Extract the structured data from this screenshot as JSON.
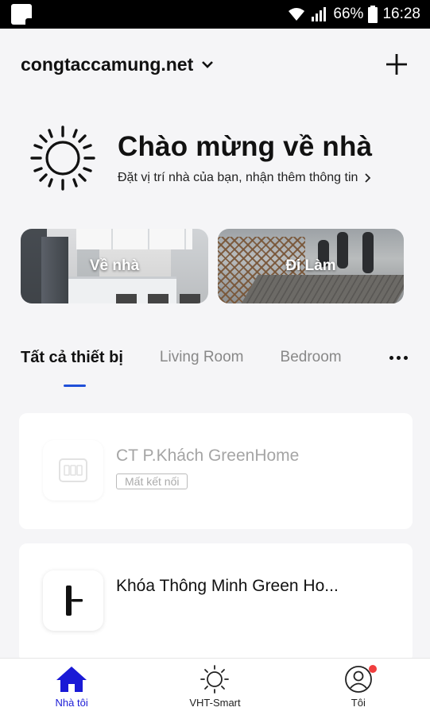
{
  "status_bar": {
    "battery_percent": "66%",
    "time": "16:28",
    "icons": [
      "app-notification-icon",
      "wifi-icon",
      "signal-icon",
      "battery-icon"
    ]
  },
  "header": {
    "home_name": "congtaccamung.net",
    "icons": [
      "chevron-down-icon",
      "plus-icon"
    ]
  },
  "welcome": {
    "title": "Chào mừng về nhà",
    "subtitle": "Đặt vị trí nhà của bạn, nhận thêm thông tin",
    "icon": "sun-icon"
  },
  "scenes": [
    {
      "label": "Về nhà"
    },
    {
      "label": "Đi Làm"
    }
  ],
  "tabs": [
    {
      "label": "Tất cả thiết bị",
      "active": true
    },
    {
      "label": "Living Room",
      "active": false
    },
    {
      "label": "Bedroom",
      "active": false
    }
  ],
  "devices": [
    {
      "name": "CT P.Khách GreenHome",
      "status": "Mất kết nối",
      "icon": "switch-panel-icon"
    },
    {
      "name": "Khóa Thông Minh Green Ho...",
      "icon": "door-lock-icon"
    }
  ],
  "bottom_nav": [
    {
      "label": "Nhà tôi",
      "icon": "home-icon",
      "active": true
    },
    {
      "label": "VHT-Smart",
      "icon": "sun-icon",
      "active": false
    },
    {
      "label": "Tôi",
      "icon": "user-icon",
      "active": false
    }
  ],
  "colors": {
    "accent": "#1f4fd8",
    "nav_active": "#1a1ad6",
    "notification_dot": "#f03e3e"
  }
}
